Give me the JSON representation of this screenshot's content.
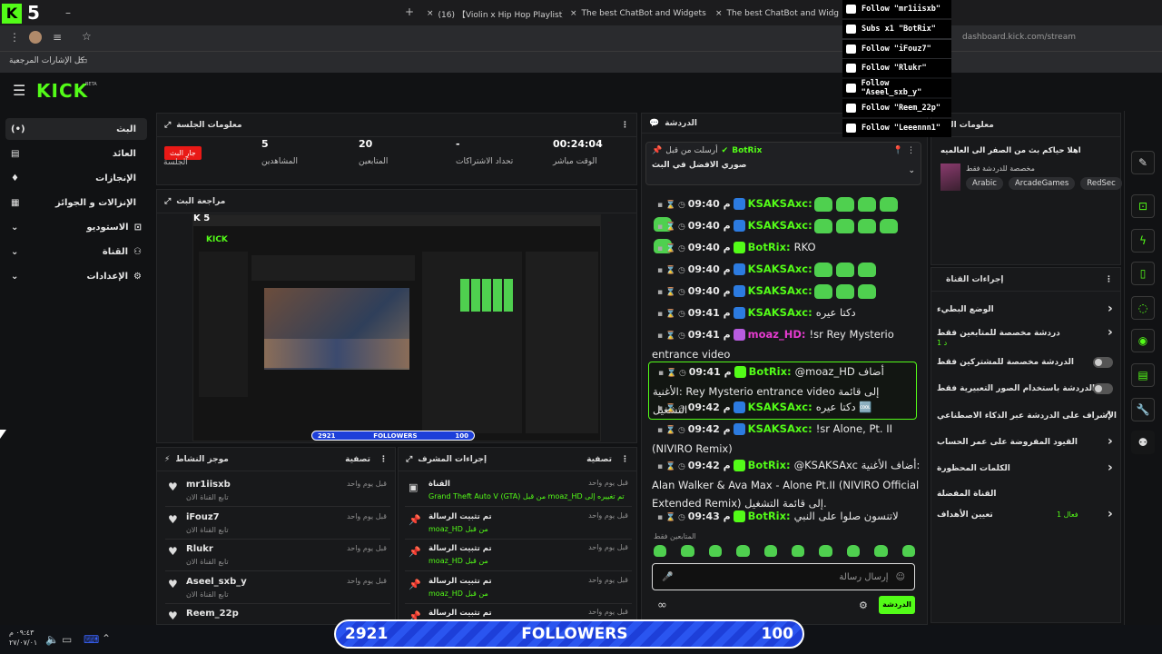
{
  "browser": {
    "tabs": [
      {
        "label": "(16) 【Violin x Hip Hop Playlist】"
      },
      {
        "label": "The best ChatBot and Widgets"
      },
      {
        "label": "The best ChatBot and Widg"
      }
    ],
    "url": "dashboard.kick.com/stream",
    "bookmarks_label": "كل الإشارات المرجعية"
  },
  "app": {
    "logo": "KICK",
    "beta": "BETA"
  },
  "sidebar": {
    "items": [
      {
        "label": "البث"
      },
      {
        "label": "العائد"
      },
      {
        "label": "الإنجازات"
      },
      {
        "label": "الإنزالات و الجوائز"
      },
      {
        "label": "الاستوديو"
      },
      {
        "label": "القناة"
      },
      {
        "label": "الإعدادات"
      }
    ]
  },
  "session": {
    "title": "معلومات الجلسة",
    "live_badge": "جارِ البث",
    "stats": [
      {
        "value": "",
        "label": "الجلسة"
      },
      {
        "value": "5",
        "label": "المشاهدين"
      },
      {
        "value": "20",
        "label": "المتابعين"
      },
      {
        "value": "-",
        "label": "تحداد الاشتراكات"
      },
      {
        "value": "00:24:04",
        "label": "الوقت مباشر"
      }
    ]
  },
  "preview": {
    "title": "مراجعة البث",
    "mini_left": "2921",
    "mini_mid": "FOLLOWERS",
    "mini_right": "100"
  },
  "activity": {
    "title": "موجز النشاط",
    "filter": "تصفية",
    "rows": [
      {
        "name": "mr1iisxb",
        "sub": "تابع القناة الان",
        "time": "قبل يوم واحد"
      },
      {
        "name": "iFouz7",
        "sub": "تابع القناة الان",
        "time": "قبل يوم واحد"
      },
      {
        "name": "Rlukr",
        "sub": "تابع القناة الان",
        "time": "قبل يوم واحد"
      },
      {
        "name": "Aseel_sxb_y",
        "sub": "تابع القناة الان",
        "time": "قبل يوم واحد"
      },
      {
        "name": "Reem_22p",
        "sub": "",
        "time": ""
      }
    ]
  },
  "modlog": {
    "title": "إجراءات المشرف",
    "filter": "تصفية",
    "rows": [
      {
        "title": "القناة",
        "detail": "Grand Theft Auto V (GTA) من قبل moaz_HD تم تغييره إلى",
        "time": "قبل يوم واحد"
      },
      {
        "title": "تم تثبيت الرسالة",
        "detail": "moaz_HD من قبل",
        "time": "قبل يوم واحد"
      },
      {
        "title": "تم تثبيت الرسالة",
        "detail": "moaz_HD من قبل",
        "time": "قبل يوم واحد"
      },
      {
        "title": "تم تثبيت الرسالة",
        "detail": "moaz_HD من قبل",
        "time": "قبل يوم واحد"
      },
      {
        "title": "تم تثبيت الرسالة",
        "detail": "",
        "time": "قبل يوم واحد"
      }
    ]
  },
  "chat": {
    "title": "الدردشة",
    "pinned": {
      "by": "أرسلت من قبل",
      "user": "BotRix",
      "text": "صوري الافضل في البث"
    },
    "messages": [
      {
        "time": "09:40 م",
        "user": "KSAKSAxc:",
        "text": ""
      },
      {
        "time": "09:40 م",
        "user": "KSAKSAxc:",
        "text": ""
      },
      {
        "time": "09:40 م",
        "user": "BotRix:",
        "text": "RKO"
      },
      {
        "time": "09:40 م",
        "user": "KSAKSAxc:",
        "text": ""
      },
      {
        "time": "09:40 م",
        "user": "KSAKSAxc:",
        "text": ""
      },
      {
        "time": "09:41 م",
        "user": "KSAKSAxc:",
        "text": "دكتا عيره"
      },
      {
        "time": "09:41 م",
        "user": "moaz_HD:",
        "text": "!sr Rey Mysterio entrance video"
      },
      {
        "time": "09:41 م",
        "user": "BotRix:",
        "text": "@moaz_HD أضاف الأغنية: Rey Mysterio entrance video إلى قائمة التشغيل"
      },
      {
        "time": "09:42 م",
        "user": "KSAKSAxc:",
        "text": "دكتا عيره 🆒"
      },
      {
        "time": "09:42 م",
        "user": "KSAKSAxc:",
        "text": "!sr Alone, Pt. II (NIVIRO Remix)"
      },
      {
        "time": "09:42 م",
        "user": "BotRix:",
        "text": "@KSAKSAxc أضاف الأغنية: Alan Walker & Ava Max - Alone Pt.II (NIVIRO Official Extended Remix) إلى قائمة التشغيل."
      },
      {
        "time": "09:43 م",
        "user": "BotRix:",
        "text": "لاتنسون صلوا على النبي"
      }
    ],
    "followers_only": "المتابعين فقط",
    "input_placeholder": "إرسال رسالة",
    "send": "الدردشة"
  },
  "info": {
    "title": "معلومات البث",
    "stream_title": "اهلا حياكم بث من الصفر الى العالميه",
    "subtitle": "مخصصة للدردشة فقط",
    "tags": [
      "Arabic",
      "ArcadeGames",
      "RedSec"
    ]
  },
  "channel": {
    "title": "إجراءات القناة",
    "rows": [
      {
        "label": "الوضع البطيء"
      },
      {
        "label": "دردشة مخصصة للمتابعين فقط",
        "sub": "1 د"
      },
      {
        "label": "الدردشة مخصصة للمشتركين فقط"
      },
      {
        "label": "الدردشة باستخدام الصور التعبيرية فقط"
      },
      {
        "label": "الإشراف على الدردشة عبر الذكاء الاصطناعي"
      },
      {
        "label": "القيود المفروضة على عمر الحساب"
      },
      {
        "label": "الكلمات المحظورة"
      },
      {
        "label": "القناة المفضلة"
      },
      {
        "label": "تعيين الأهداف",
        "sub": "فعال 1"
      }
    ]
  },
  "alerts": [
    {
      "text": "Follow \"mr1iisxb\""
    },
    {
      "text": "Subs x1 \"BotRix\""
    },
    {
      "text": "Follow \"iFouz7\""
    },
    {
      "text": "Follow \"Rlukr\""
    },
    {
      "text": "Follow \"Aseel_sxb_y\""
    },
    {
      "text": "Follow \"Reem_22p\""
    },
    {
      "text": "Follow \"Leeennn1\""
    }
  ],
  "goal": {
    "current": "2921",
    "label": "FOLLOWERS",
    "target": "100"
  },
  "taskbar": {
    "time": "٠٩:٤٣ م",
    "date": "٢٧/٠٧/٠١"
  },
  "colors": {
    "accent": "#53fc18",
    "live": "#e91916",
    "goal_bar": "#1d3fd9"
  }
}
